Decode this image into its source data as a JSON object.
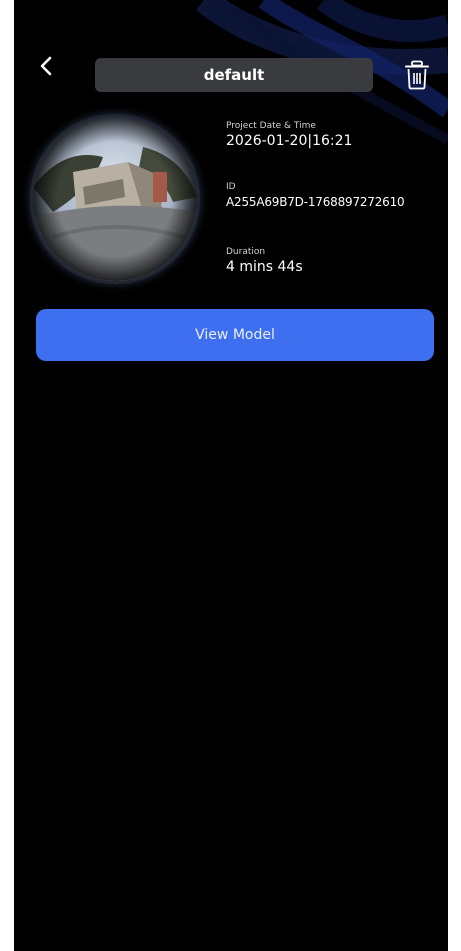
{
  "header": {
    "title": "default",
    "back_icon": "chevron-left-icon",
    "delete_icon": "trash-icon"
  },
  "project": {
    "thumbnail": "fisheye-street-photo",
    "date_label": "Project Date & Time",
    "date_value": "2026-01-20|16:21",
    "id_label": "ID",
    "id_value": "A255A69B7D-1768897272610",
    "duration_label": "Duration",
    "duration_value": "4 mins 44s"
  },
  "actions": {
    "view_model_label": "View Model"
  },
  "colors": {
    "background": "#000000",
    "pill": "#3a3b3f",
    "accent_button": "#3e6ff0"
  }
}
